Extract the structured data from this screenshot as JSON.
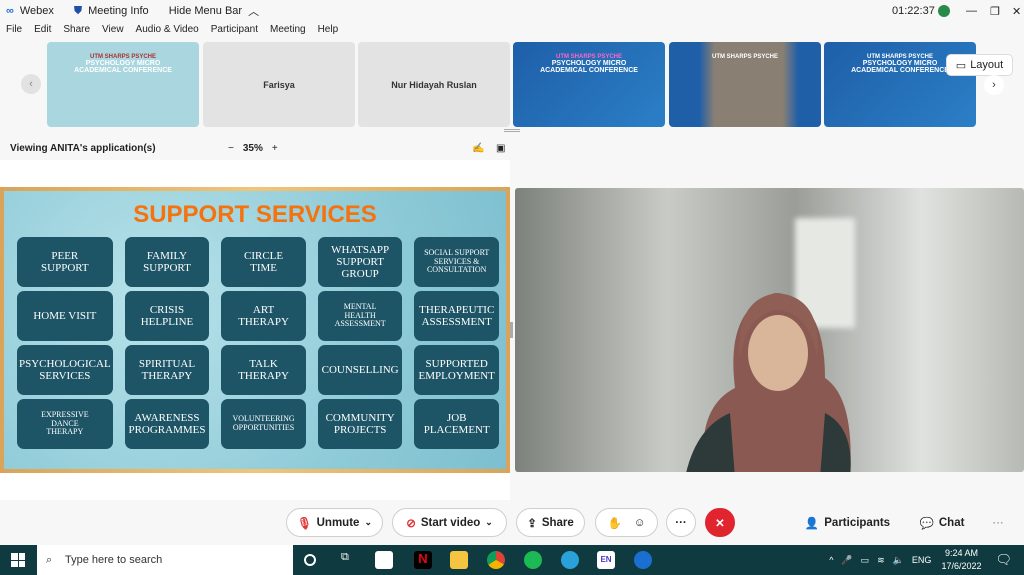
{
  "titlebar": {
    "app": "Webex",
    "meeting_info": "Meeting Info",
    "hide_menu": "Hide Menu Bar",
    "timer": "01:22:37"
  },
  "menu": [
    "File",
    "Edit",
    "Share",
    "View",
    "Audio & Video",
    "Participant",
    "Meeting",
    "Help"
  ],
  "filmstrip": {
    "conf_title": "PSYCHOLOGY MICRO ACADEMICAL CONFERENCE",
    "logos": "UTM SHARPS PSYCHE",
    "participants": [
      "Farisya",
      "Nur Hidayah Ruslan"
    ],
    "layout_label": "Layout"
  },
  "viewing": {
    "label": "Viewing ANITA's application(s)",
    "zoom": "35%",
    "minus": "−",
    "plus": "+"
  },
  "slide": {
    "title": "SUPPORT SERVICES",
    "services": [
      "PEER\nSUPPORT",
      "FAMILY\nSUPPORT",
      "CIRCLE\nTIME",
      "WHATSAPP\nSUPPORT\nGROUP",
      "SOCIAL SUPPORT\nSERVICES &\nCONSULTATION",
      "HOME VISIT",
      "CRISIS\nHELPLINE",
      "ART\nTHERAPY",
      "MENTAL\nHEALTH\nASSESSMENT",
      "THERAPEUTIC\nASSESSMENT",
      "PSYCHOLOGICAL\nSERVICES",
      "SPIRITUAL\nTHERAPY",
      "TALK\nTHERAPY",
      "COUNSELLING",
      "SUPPORTED\nEMPLOYMENT",
      "EXPRESSIVE\nDANCE\nTHERAPY",
      "AWARENESS\nPROGRAMMES",
      "VOLUNTEERING\nOPPORTUNITIES",
      "COMMUNITY\nPROJECTS",
      "JOB\nPLACEMENT"
    ]
  },
  "controls": {
    "unmute": "Unmute",
    "start_video": "Start video",
    "share": "Share",
    "more": "···",
    "participants": "Participants",
    "chat": "Chat"
  },
  "taskbar": {
    "search_placeholder": "Type here to search",
    "lang": "ENG",
    "time": "9:24 AM",
    "date": "17/6/2022",
    "en_badge": "EN"
  },
  "colors": {
    "end_call": "#e0252f",
    "slide_title": "#f5720e",
    "tile": "#1d5567",
    "taskbar": "#0f3a3f"
  }
}
